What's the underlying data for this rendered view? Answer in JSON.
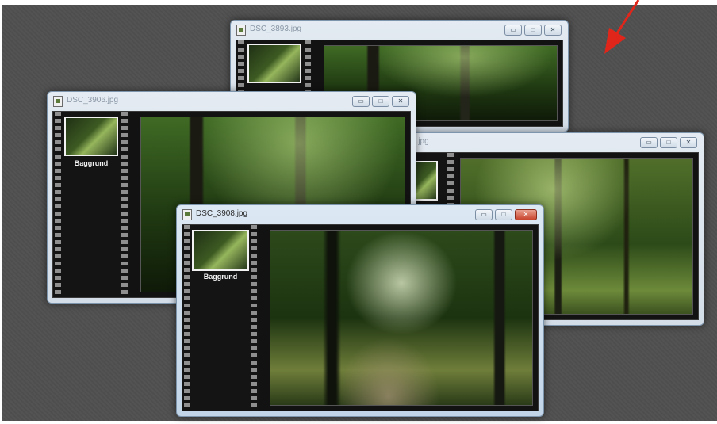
{
  "windows": [
    {
      "title": "DSC_3893.jpg",
      "state": "inactive"
    },
    {
      "title": "DSC_3906.jpg",
      "state": "inactive",
      "thumb_label": "Baggrund"
    },
    {
      "title": "3.jpg",
      "state": "inactive"
    },
    {
      "title": "DSC_3908.jpg",
      "state": "active",
      "thumb_label": "Baggrund"
    }
  ],
  "icons": {
    "minimize": "minimize-icon",
    "maximize": "maximize-icon",
    "close": "close-icon",
    "document": "image-document-icon",
    "arrow": "red-arrow-icon"
  },
  "colors": {
    "desktop": "#505050",
    "arrow": "#e0261b",
    "titlebar": "#c2d5e8",
    "close_active": "#c8442d"
  }
}
